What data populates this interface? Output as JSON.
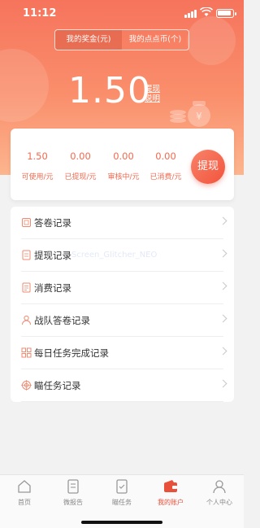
{
  "status": {
    "time": "11:12"
  },
  "segments": [
    {
      "label": "我的奖金(元)"
    },
    {
      "label": "我的点点币(个)"
    }
  ],
  "balance": "1.50",
  "explain": "提现说明",
  "stats": [
    {
      "value": "1.50",
      "label": "可使用/元"
    },
    {
      "value": "0.00",
      "label": "已提现/元"
    },
    {
      "value": "0.00",
      "label": "审核中/元"
    },
    {
      "value": "0.00",
      "label": "已消费/元"
    }
  ],
  "withdraw_label": "提现",
  "records": [
    {
      "label": "答卷记录",
      "icon": "answer-sheet-icon"
    },
    {
      "label": "提现记录",
      "icon": "withdraw-doc-icon"
    },
    {
      "label": "消费记录",
      "icon": "consume-doc-icon"
    },
    {
      "label": "战队答卷记录",
      "icon": "team-person-icon"
    },
    {
      "label": "每日任务完成记录",
      "icon": "grid-icon"
    },
    {
      "label": "瞄任务记录",
      "icon": "target-icon"
    }
  ],
  "watermark": "Screen_Glitcher_NEO",
  "tabs": [
    {
      "label": "首页",
      "icon": "home-icon"
    },
    {
      "label": "微报告",
      "icon": "report-icon"
    },
    {
      "label": "瞄任务",
      "icon": "task-icon"
    },
    {
      "label": "我的账户",
      "icon": "wallet-icon",
      "active": true
    },
    {
      "label": "个人中心",
      "icon": "person-icon"
    }
  ],
  "colors": {
    "accent": "#f06a50",
    "hero_top": "#f6745c",
    "active_tab": "#e8503a"
  }
}
